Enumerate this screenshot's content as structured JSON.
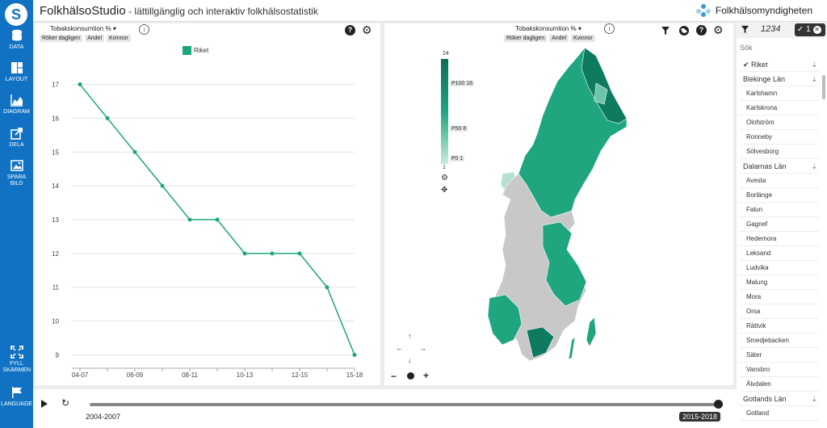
{
  "app": {
    "title": "FolkhälsoStudio",
    "subtitle": " - lättillgänglig och interaktiv folkhälsostatistik",
    "org": "Folkhälsomyndigheten"
  },
  "nav": [
    {
      "label": "DATA",
      "icon": "database-icon"
    },
    {
      "label": "LAYOUT",
      "icon": "layout-icon"
    },
    {
      "label": "DIAGRAM",
      "icon": "chart-icon"
    },
    {
      "label": "DELA",
      "icon": "share-icon"
    },
    {
      "label": "SPARA BILD",
      "icon": "image-icon"
    },
    {
      "label": "FYLL SKÄRMEN",
      "icon": "fullscreen-icon"
    },
    {
      "label": "LANGUAGE",
      "icon": "flag-icon"
    }
  ],
  "chart_panel": {
    "title": "Tobakskonsumtion % ▾",
    "chips": [
      "Röker dagligen",
      "Andel",
      "Kvinnor"
    ],
    "legend": "Riket"
  },
  "map_panel": {
    "title": "Tobakskonsumtion % ▾",
    "chips": [
      "Röker dagligen",
      "Andel",
      "Kvinnor"
    ],
    "scale": {
      "max": "24",
      "min": "1",
      "p100": "P100 18",
      "p50": "P50 8",
      "p0": "P0 1"
    }
  },
  "list": {
    "count": "1234",
    "selected_count": "1",
    "search_placeholder": "Sök",
    "items": [
      {
        "label": "Riket",
        "type": "group",
        "checked": true
      },
      {
        "label": "Blekinge Län",
        "type": "group"
      },
      {
        "label": "Karlshamn",
        "type": "item"
      },
      {
        "label": "Karlskrona",
        "type": "item"
      },
      {
        "label": "Olofström",
        "type": "item"
      },
      {
        "label": "Ronneby",
        "type": "item"
      },
      {
        "label": "Sölvesborg",
        "type": "item"
      },
      {
        "label": "Dalarnas Län",
        "type": "group"
      },
      {
        "label": "Avesta",
        "type": "item"
      },
      {
        "label": "Borlänge",
        "type": "item"
      },
      {
        "label": "Falun",
        "type": "item"
      },
      {
        "label": "Gagnef",
        "type": "item"
      },
      {
        "label": "Hedemora",
        "type": "item"
      },
      {
        "label": "Leksand",
        "type": "item"
      },
      {
        "label": "Ludvika",
        "type": "item"
      },
      {
        "label": "Malung",
        "type": "item"
      },
      {
        "label": "Mora",
        "type": "item"
      },
      {
        "label": "Orsa",
        "type": "item"
      },
      {
        "label": "Rättvik",
        "type": "item"
      },
      {
        "label": "Smedjebacken",
        "type": "item"
      },
      {
        "label": "Säter",
        "type": "item"
      },
      {
        "label": "Vansbro",
        "type": "item"
      },
      {
        "label": "Älvdalen",
        "type": "item"
      },
      {
        "label": "Gotlands Län",
        "type": "group"
      },
      {
        "label": "Gotland",
        "type": "item"
      }
    ]
  },
  "timeline": {
    "start": "2004-2007",
    "end": "2015-2018"
  },
  "colors": {
    "accent": "#1fa67e",
    "nav": "#1172c4",
    "map_dark": "#0e7a5f",
    "map_light": "#b3e0d2",
    "map_gray": "#c8c8c8"
  },
  "chart_data": {
    "type": "line",
    "categories": [
      "04-07",
      "05-08",
      "06-09",
      "07-10",
      "08-11",
      "09-12",
      "10-13",
      "11-14",
      "12-15",
      "13-16",
      "15-18"
    ],
    "tick_labels": [
      "04-07",
      "06-09",
      "08-11",
      "10-13",
      "12-15",
      "15-18"
    ],
    "series": [
      {
        "name": "Riket",
        "values": [
          17,
          16,
          15,
          14,
          13,
          13,
          12,
          12,
          12,
          11,
          9
        ]
      }
    ],
    "ylim": [
      8.7,
      17.3
    ],
    "yticks": [
      9,
      10,
      11,
      12,
      13,
      14,
      15,
      16,
      17
    ],
    "grid": true,
    "legend": "top-center"
  }
}
